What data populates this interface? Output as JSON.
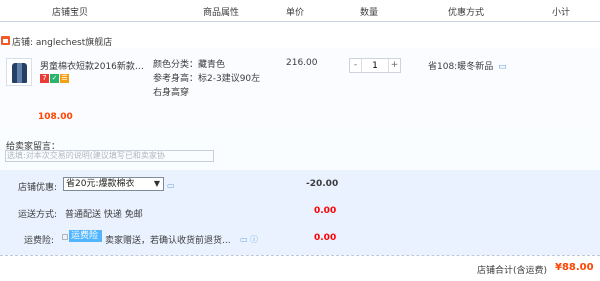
{
  "header": {
    "cols": [
      "店铺宝贝",
      "商品属性",
      "单价",
      "数量",
      "优惠方式",
      "小计"
    ]
  },
  "shop": {
    "label": "店铺: anglechest旗舰店"
  },
  "item": {
    "title": "男童棉衣短款2016新款童...",
    "attr_color": "颜色分类：藏青色",
    "attr_height": "参考身高：标2-3建议90左",
    "attr_note": "右身高穿",
    "unit_price": "216.00",
    "quantity": "1",
    "promo": "省108:暖冬新品",
    "promo_icon": "▭",
    "subtotal": "108.00"
  },
  "message": {
    "label": "给卖家留言：",
    "placeholder": "选填:对本次交易的说明(建议填写已和卖家协"
  },
  "shop_discount": {
    "label": "店铺优惠:",
    "selected": "省20元:爆款棉衣",
    "value": "-20.00"
  },
  "shipping": {
    "label": "运送方式:",
    "method": "普通配送 快递 免邮",
    "value": "0.00"
  },
  "insurance": {
    "label": "运费险:",
    "tag": "运费险",
    "desc": "卖家赠送，若确认收货前退货...",
    "value": "0.00"
  },
  "footer": {
    "label": "店铺合计(含运费)",
    "total": "¥88.00"
  },
  "colors": {
    "accent": "#ff4400",
    "link": "#60a1d8",
    "panel": "#eaf2ff"
  }
}
